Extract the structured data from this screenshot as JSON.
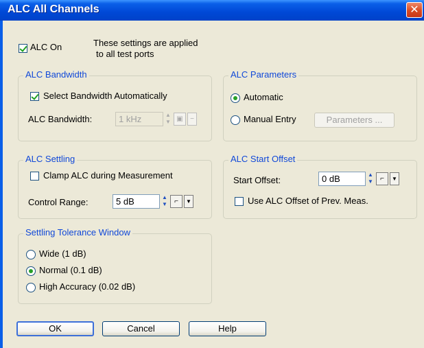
{
  "window": {
    "title": "ALC All Channels",
    "close_glyph": "✕"
  },
  "alc_on": {
    "label": "ALC On",
    "checked": true,
    "note_line1": "These settings are applied",
    "note_line2": "to all test ports"
  },
  "bandwidth": {
    "group_label": "ALC Bandwidth",
    "auto_label": "Select Bandwidth Automatically",
    "auto_checked": true,
    "field_label": "ALC Bandwidth:",
    "value": "1 kHz"
  },
  "parameters": {
    "group_label": "ALC Parameters",
    "automatic_label": "Automatic",
    "manual_label": "Manual Entry",
    "button_label": "Parameters ...",
    "selected": "automatic"
  },
  "settling": {
    "group_label": "ALC Settling",
    "clamp_label": "Clamp ALC during Measurement",
    "clamp_checked": false,
    "range_label": "Control Range:",
    "range_value": "5 dB"
  },
  "start_offset": {
    "group_label": "ALC Start Offset",
    "field_label": "Start Offset:",
    "value": "0 dB",
    "use_prev_label": "Use ALC Offset of Prev. Meas.",
    "use_prev_checked": false
  },
  "tolerance": {
    "group_label": "Settling Tolerance Window",
    "options": [
      "Wide (1 dB)",
      "Normal (0.1 dB)",
      "High Accuracy (0.02 dB)"
    ],
    "selected": "Normal (0.1 dB)"
  },
  "buttons": {
    "ok": "OK",
    "cancel": "Cancel",
    "help": "Help"
  },
  "icons": {
    "spin_up": "▲",
    "spin_down": "▼",
    "step": "⌐",
    "dropdown": "▼",
    "bw_icon": "▣",
    "bw_minus": "−"
  }
}
